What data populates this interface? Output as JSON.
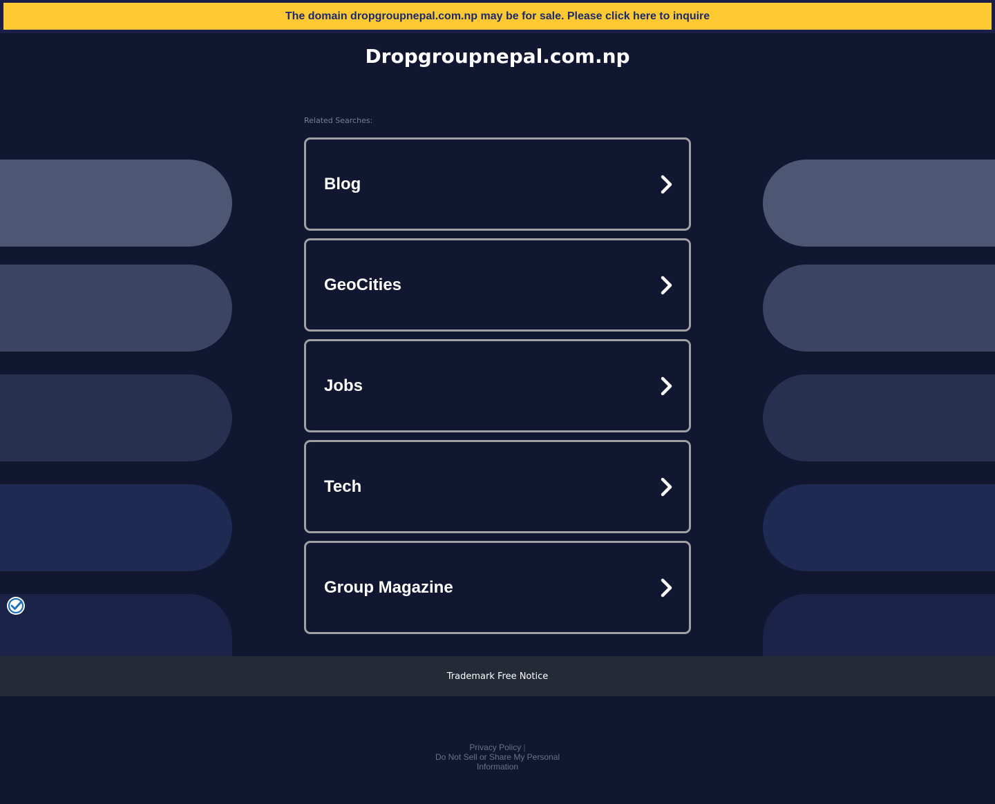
{
  "banner": {
    "text": "The domain dropgroupnepal.com.np may be for sale. Please click here to inquire"
  },
  "site": {
    "title": "Dropgroupnepal.com.np"
  },
  "related": {
    "label": "Related Searches:",
    "items": [
      {
        "label": "Blog"
      },
      {
        "label": "GeoCities"
      },
      {
        "label": "Jobs"
      },
      {
        "label": "Tech"
      },
      {
        "label": "Group Magazine"
      }
    ]
  },
  "trademark": {
    "label": "Trademark Free Notice"
  },
  "footer": {
    "privacy": "Privacy Policy",
    "separator": "|",
    "do_not_sell": "Do Not Sell or Share My Personal Information"
  },
  "colors": {
    "background": "#111730",
    "banner_bg": "#fec933",
    "banner_text": "#1c2b6c",
    "card_border": "#a0a0a4",
    "trademark_bar": "#242b37"
  },
  "icons": {
    "chevron": "chevron-right-icon",
    "privacy": "privacy-shield-check-icon"
  }
}
